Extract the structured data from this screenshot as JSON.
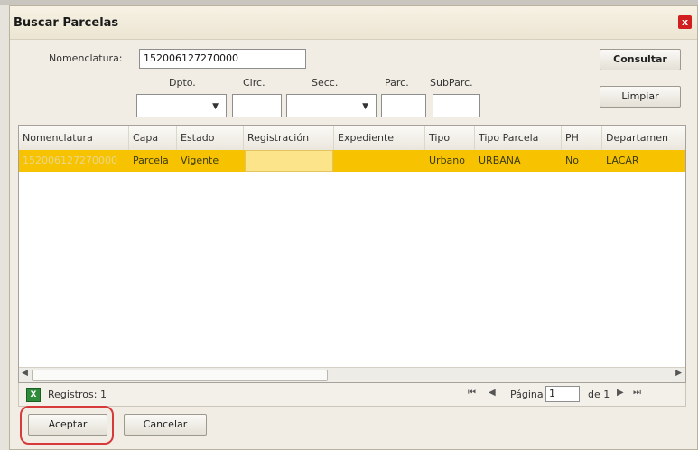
{
  "dialog": {
    "title": "Buscar Parcelas",
    "close_glyph": "x"
  },
  "search": {
    "nomenclatura_label": "Nomenclatura:",
    "nomenclatura_value": "152006127270000",
    "consultar_label": "Consultar",
    "limpiar_label": "Limpiar",
    "fields": {
      "dpto_label": "Dpto.",
      "circ_label": "Circ.",
      "secc_label": "Secc.",
      "parc_label": "Parc.",
      "subparc_label": "SubParc."
    }
  },
  "grid": {
    "columns": [
      "Nomenclatura",
      "Capa",
      "Estado",
      "Registración",
      "Expediente",
      "Tipo",
      "Tipo Parcela",
      "PH",
      "Departamen"
    ],
    "rows": [
      [
        "152006127270000",
        "Parcela",
        "Vigente",
        "",
        "",
        "Urbano",
        "URBANA",
        "No",
        "LACAR"
      ]
    ]
  },
  "pager": {
    "records_label": "Registros: 1",
    "page_label": "Página",
    "page_value": "1",
    "of_label": "de 1",
    "first_glyph": "⏮",
    "prev_glyph": "◀",
    "next_glyph": "▶",
    "last_glyph": "⏭"
  },
  "footer": {
    "aceptar_label": "Aceptar",
    "cancelar_label": "Cancelar"
  },
  "icons": {
    "export": "excel-export-icon"
  },
  "colors": {
    "selected_row": "#f7c300",
    "close_button": "#d11e1e",
    "highlight_circle": "#d63a3a"
  }
}
